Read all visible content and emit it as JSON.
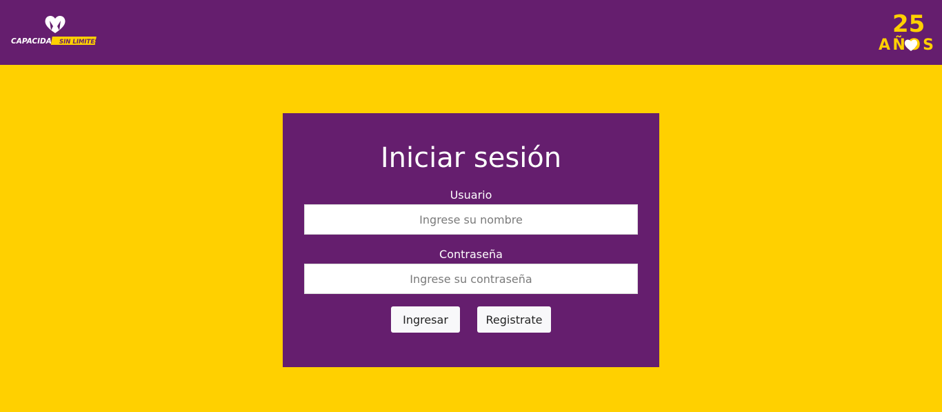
{
  "header": {
    "brand_name": "CAPACIDAD SIN LIMITES",
    "brand_part1": "CAPACIDAD",
    "brand_part2": "SIN LIMITES",
    "anniversary_number": "25",
    "anniversary_word": "AÑOS"
  },
  "login": {
    "title": "Iniciar sesión",
    "username_label": "Usuario",
    "username_placeholder": "Ingrese su nombre",
    "username_value": "",
    "password_label": "Contraseña",
    "password_placeholder": "Ingrese su contraseña",
    "password_value": "",
    "login_button": "Ingresar",
    "register_button": "Registrate"
  },
  "colors": {
    "header_bg": "#651e6e",
    "page_bg": "#ffd000",
    "card_bg": "#651e6e",
    "logo_accent": "#ffd000",
    "text_light": "#ffffff"
  },
  "icons": {
    "brand_logo": "heart-hands-logo-icon",
    "anniversary_logo": "25-anos-heart-logo-icon"
  }
}
